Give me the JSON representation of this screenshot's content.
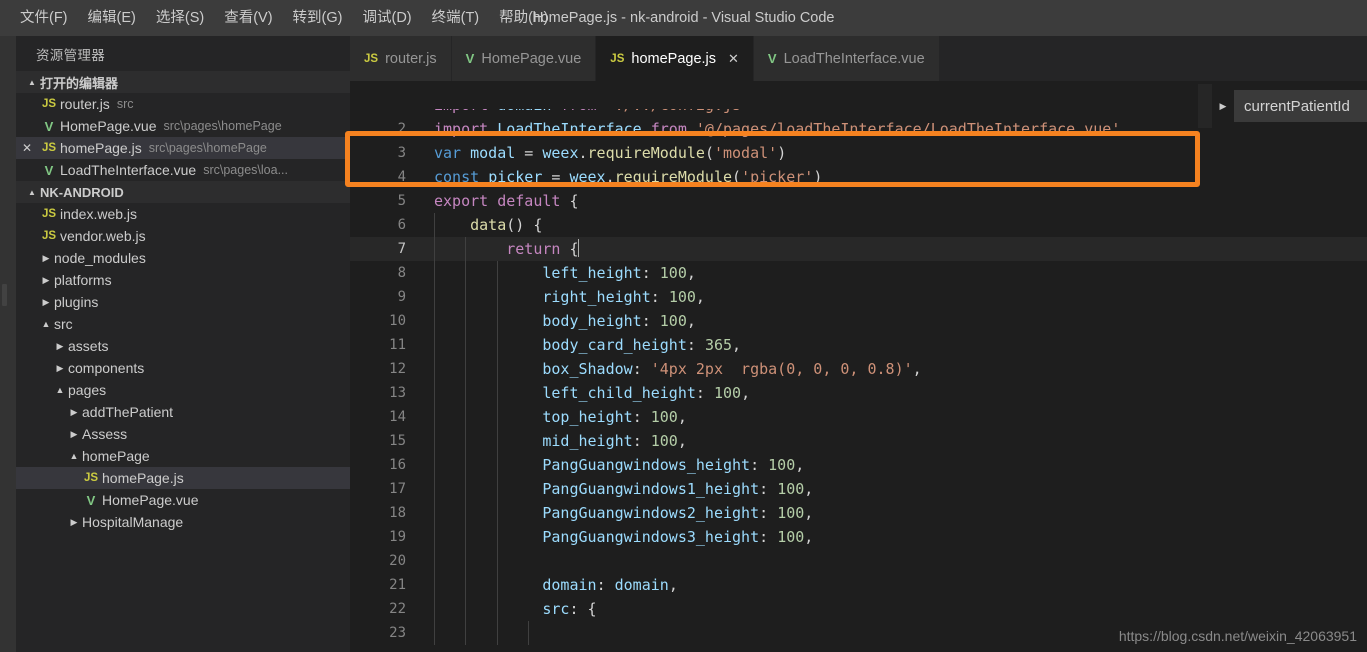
{
  "window": {
    "title": "homePage.js - nk-android - Visual Studio Code"
  },
  "menubar": {
    "items": [
      {
        "label": "文件(F)",
        "name": "menu-file"
      },
      {
        "label": "编辑(E)",
        "name": "menu-edit"
      },
      {
        "label": "选择(S)",
        "name": "menu-selection"
      },
      {
        "label": "查看(V)",
        "name": "menu-view"
      },
      {
        "label": "转到(G)",
        "name": "menu-go"
      },
      {
        "label": "调试(D)",
        "name": "menu-debug"
      },
      {
        "label": "终端(T)",
        "name": "menu-terminal"
      },
      {
        "label": "帮助(H)",
        "name": "menu-help"
      }
    ]
  },
  "sidebar": {
    "title": "资源管理器",
    "open_editors": {
      "header": "打开的编辑器",
      "twisty": "▲",
      "items": [
        {
          "icon": "js-file-icon",
          "icon_text": "JS",
          "label": "router.js",
          "desc": "src",
          "dirty": false,
          "selected": false
        },
        {
          "icon": "vue-file-icon",
          "icon_text": "V",
          "label": "HomePage.vue",
          "desc": "src\\pages\\homePage",
          "dirty": false,
          "selected": false
        },
        {
          "icon": "js-file-icon",
          "icon_text": "JS",
          "label": "homePage.js",
          "desc": "src\\pages\\homePage",
          "dirty": true,
          "close_glyph": "✕",
          "selected": true
        },
        {
          "icon": "vue-file-icon",
          "icon_text": "V",
          "label": "LoadTheInterface.vue",
          "desc": "src\\pages\\loa...",
          "dirty": false,
          "selected": false
        }
      ]
    },
    "project": {
      "header": "NK-ANDROID",
      "twisty": "▲",
      "items": [
        {
          "kind": "file",
          "icon_text": "JS",
          "icon": "js-file-icon",
          "label": "index.web.js",
          "indent": 1,
          "selected": false
        },
        {
          "kind": "file",
          "icon_text": "JS",
          "icon": "js-file-icon",
          "label": "vendor.web.js",
          "indent": 1,
          "selected": false
        },
        {
          "kind": "folder",
          "twisty": "▶",
          "label": "node_modules",
          "indent": 1,
          "selected": false
        },
        {
          "kind": "folder",
          "twisty": "▶",
          "label": "platforms",
          "indent": 1,
          "selected": false
        },
        {
          "kind": "folder",
          "twisty": "▶",
          "label": "plugins",
          "indent": 1,
          "selected": false
        },
        {
          "kind": "folder",
          "twisty": "▲",
          "label": "src",
          "indent": 1,
          "selected": false
        },
        {
          "kind": "folder",
          "twisty": "▶",
          "label": "assets",
          "indent": 2,
          "selected": false
        },
        {
          "kind": "folder",
          "twisty": "▶",
          "label": "components",
          "indent": 2,
          "selected": false
        },
        {
          "kind": "folder",
          "twisty": "▲",
          "label": "pages",
          "indent": 2,
          "selected": false
        },
        {
          "kind": "folder",
          "twisty": "▶",
          "label": "addThePatient",
          "indent": 3,
          "selected": false
        },
        {
          "kind": "folder",
          "twisty": "▶",
          "label": "Assess",
          "indent": 3,
          "selected": false
        },
        {
          "kind": "folder",
          "twisty": "▲",
          "label": "homePage",
          "indent": 3,
          "selected": false
        },
        {
          "kind": "file",
          "icon_text": "JS",
          "icon": "js-file-icon",
          "label": "homePage.js",
          "indent": 4,
          "selected": true
        },
        {
          "kind": "file",
          "icon_text": "V",
          "icon": "vue-file-icon",
          "label": "HomePage.vue",
          "indent": 4,
          "selected": false
        },
        {
          "kind": "folder",
          "twisty": "▶",
          "label": "HospitalManage",
          "indent": 3,
          "selected": false
        }
      ]
    }
  },
  "tabs": [
    {
      "icon": "js-file-icon",
      "icon_text": "JS",
      "label": "router.js",
      "active": false,
      "close": ""
    },
    {
      "icon": "vue-file-icon",
      "icon_text": "V",
      "label": "HomePage.vue",
      "active": false,
      "close": ""
    },
    {
      "icon": "js-file-icon",
      "icon_text": "JS",
      "label": "homePage.js",
      "active": true,
      "close": "✕"
    },
    {
      "icon": "vue-file-icon",
      "icon_text": "V",
      "label": "LoadTheInterface.vue",
      "active": false,
      "close": ""
    }
  ],
  "float_panel": {
    "chevron": "▶",
    "label": "currentPatientId"
  },
  "annotation": {
    "color": "#f58220",
    "covers_lines": "1-3"
  },
  "watermark": "https://blog.csdn.net/weixin_42063951",
  "editor": {
    "active_line": 7,
    "lines": [
      {
        "n": "1",
        "clipped_top": true,
        "tokens": [
          {
            "t": "import ",
            "c": "t-kw"
          },
          {
            "t": "domain",
            "c": "t-id"
          },
          {
            "t": " from ",
            "c": "t-kw"
          },
          {
            "t": "'./../config.js'",
            "c": "t-str"
          }
        ]
      },
      {
        "n": "2",
        "tokens": [
          {
            "t": "import ",
            "c": "t-kw"
          },
          {
            "t": "LoadTheInterface",
            "c": "t-id"
          },
          {
            "t": " from ",
            "c": "t-kw"
          },
          {
            "t": "'@/pages/loadTheInterface/LoadTheInterface.vue'",
            "c": "t-str"
          }
        ]
      },
      {
        "n": "3",
        "clipped_bottom": true,
        "tokens": [
          {
            "t": "var ",
            "c": "t-var"
          },
          {
            "t": "modal",
            "c": "t-id"
          },
          {
            "t": " = ",
            "c": "t-pn"
          },
          {
            "t": "weex",
            "c": "t-id"
          },
          {
            "t": ".",
            "c": "t-pn"
          },
          {
            "t": "requireModule",
            "c": "t-fn"
          },
          {
            "t": "(",
            "c": "t-pn"
          },
          {
            "t": "'modal'",
            "c": "t-str"
          },
          {
            "t": ")",
            "c": "t-pn"
          }
        ]
      },
      {
        "n": "4",
        "tokens": [
          {
            "t": "const ",
            "c": "t-var"
          },
          {
            "t": "picker",
            "c": "t-id"
          },
          {
            "t": " = ",
            "c": "t-pn"
          },
          {
            "t": "weex",
            "c": "t-id"
          },
          {
            "t": ".",
            "c": "t-pn"
          },
          {
            "t": "requireModule",
            "c": "t-fn"
          },
          {
            "t": "(",
            "c": "t-pn"
          },
          {
            "t": "'picker'",
            "c": "t-str"
          },
          {
            "t": ")",
            "c": "t-pn"
          }
        ]
      },
      {
        "n": "5",
        "tokens": [
          {
            "t": "export ",
            "c": "t-kw"
          },
          {
            "t": "default ",
            "c": "t-kw"
          },
          {
            "t": "{",
            "c": "t-pn"
          }
        ]
      },
      {
        "n": "6",
        "indent": 1,
        "tokens": [
          {
            "t": "    ",
            "c": "t-pn"
          },
          {
            "t": "data",
            "c": "t-fn"
          },
          {
            "t": "() {",
            "c": "t-pn"
          }
        ]
      },
      {
        "n": "7",
        "indent": 2,
        "active": true,
        "cursor_after": "return {",
        "tokens": [
          {
            "t": "        ",
            "c": "t-pn"
          },
          {
            "t": "return ",
            "c": "t-kw"
          },
          {
            "t": "{",
            "c": "t-pn"
          }
        ]
      },
      {
        "n": "8",
        "indent": 3,
        "tokens": [
          {
            "t": "            ",
            "c": "t-pn"
          },
          {
            "t": "left_height",
            "c": "t-id"
          },
          {
            "t": ": ",
            "c": "t-pn"
          },
          {
            "t": "100",
            "c": "t-num"
          },
          {
            "t": ",",
            "c": "t-pn"
          }
        ]
      },
      {
        "n": "9",
        "indent": 3,
        "tokens": [
          {
            "t": "            ",
            "c": "t-pn"
          },
          {
            "t": "right_height",
            "c": "t-id"
          },
          {
            "t": ": ",
            "c": "t-pn"
          },
          {
            "t": "100",
            "c": "t-num"
          },
          {
            "t": ",",
            "c": "t-pn"
          }
        ]
      },
      {
        "n": "10",
        "indent": 3,
        "tokens": [
          {
            "t": "            ",
            "c": "t-pn"
          },
          {
            "t": "body_height",
            "c": "t-id"
          },
          {
            "t": ": ",
            "c": "t-pn"
          },
          {
            "t": "100",
            "c": "t-num"
          },
          {
            "t": ",",
            "c": "t-pn"
          }
        ]
      },
      {
        "n": "11",
        "indent": 3,
        "tokens": [
          {
            "t": "            ",
            "c": "t-pn"
          },
          {
            "t": "body_card_height",
            "c": "t-id"
          },
          {
            "t": ": ",
            "c": "t-pn"
          },
          {
            "t": "365",
            "c": "t-num"
          },
          {
            "t": ",",
            "c": "t-pn"
          }
        ]
      },
      {
        "n": "12",
        "indent": 3,
        "tokens": [
          {
            "t": "            ",
            "c": "t-pn"
          },
          {
            "t": "box_Shadow",
            "c": "t-id"
          },
          {
            "t": ": ",
            "c": "t-pn"
          },
          {
            "t": "'4px 2px  rgba(0, 0, 0, 0.8)'",
            "c": "t-str"
          },
          {
            "t": ",",
            "c": "t-pn"
          }
        ]
      },
      {
        "n": "13",
        "indent": 3,
        "tokens": [
          {
            "t": "            ",
            "c": "t-pn"
          },
          {
            "t": "left_child_height",
            "c": "t-id"
          },
          {
            "t": ": ",
            "c": "t-pn"
          },
          {
            "t": "100",
            "c": "t-num"
          },
          {
            "t": ",",
            "c": "t-pn"
          }
        ]
      },
      {
        "n": "14",
        "indent": 3,
        "tokens": [
          {
            "t": "            ",
            "c": "t-pn"
          },
          {
            "t": "top_height",
            "c": "t-id"
          },
          {
            "t": ": ",
            "c": "t-pn"
          },
          {
            "t": "100",
            "c": "t-num"
          },
          {
            "t": ",",
            "c": "t-pn"
          }
        ]
      },
      {
        "n": "15",
        "indent": 3,
        "tokens": [
          {
            "t": "            ",
            "c": "t-pn"
          },
          {
            "t": "mid_height",
            "c": "t-id"
          },
          {
            "t": ": ",
            "c": "t-pn"
          },
          {
            "t": "100",
            "c": "t-num"
          },
          {
            "t": ",",
            "c": "t-pn"
          }
        ]
      },
      {
        "n": "16",
        "indent": 3,
        "tokens": [
          {
            "t": "            ",
            "c": "t-pn"
          },
          {
            "t": "PangGuangwindows_height",
            "c": "t-id"
          },
          {
            "t": ": ",
            "c": "t-pn"
          },
          {
            "t": "100",
            "c": "t-num"
          },
          {
            "t": ",",
            "c": "t-pn"
          }
        ]
      },
      {
        "n": "17",
        "indent": 3,
        "tokens": [
          {
            "t": "            ",
            "c": "t-pn"
          },
          {
            "t": "PangGuangwindows1_height",
            "c": "t-id"
          },
          {
            "t": ": ",
            "c": "t-pn"
          },
          {
            "t": "100",
            "c": "t-num"
          },
          {
            "t": ",",
            "c": "t-pn"
          }
        ]
      },
      {
        "n": "18",
        "indent": 3,
        "tokens": [
          {
            "t": "            ",
            "c": "t-pn"
          },
          {
            "t": "PangGuangwindows2_height",
            "c": "t-id"
          },
          {
            "t": ": ",
            "c": "t-pn"
          },
          {
            "t": "100",
            "c": "t-num"
          },
          {
            "t": ",",
            "c": "t-pn"
          }
        ]
      },
      {
        "n": "19",
        "indent": 3,
        "tokens": [
          {
            "t": "            ",
            "c": "t-pn"
          },
          {
            "t": "PangGuangwindows3_height",
            "c": "t-id"
          },
          {
            "t": ": ",
            "c": "t-pn"
          },
          {
            "t": "100",
            "c": "t-num"
          },
          {
            "t": ",",
            "c": "t-pn"
          }
        ]
      },
      {
        "n": "20",
        "indent": 3,
        "tokens": []
      },
      {
        "n": "21",
        "indent": 3,
        "tokens": [
          {
            "t": "            ",
            "c": "t-pn"
          },
          {
            "t": "domain",
            "c": "t-id"
          },
          {
            "t": ": ",
            "c": "t-pn"
          },
          {
            "t": "domain",
            "c": "t-id"
          },
          {
            "t": ",",
            "c": "t-pn"
          }
        ]
      },
      {
        "n": "22",
        "indent": 3,
        "tokens": [
          {
            "t": "            ",
            "c": "t-pn"
          },
          {
            "t": "src",
            "c": "t-id"
          },
          {
            "t": ": {",
            "c": "t-pn"
          }
        ]
      },
      {
        "n": "23",
        "clipped_bottom": true,
        "indent": 4,
        "tokens": [
          {
            "t": "                ",
            "c": "t-pn"
          },
          {
            "t": "",
            "c": "t-pn"
          }
        ]
      }
    ]
  }
}
